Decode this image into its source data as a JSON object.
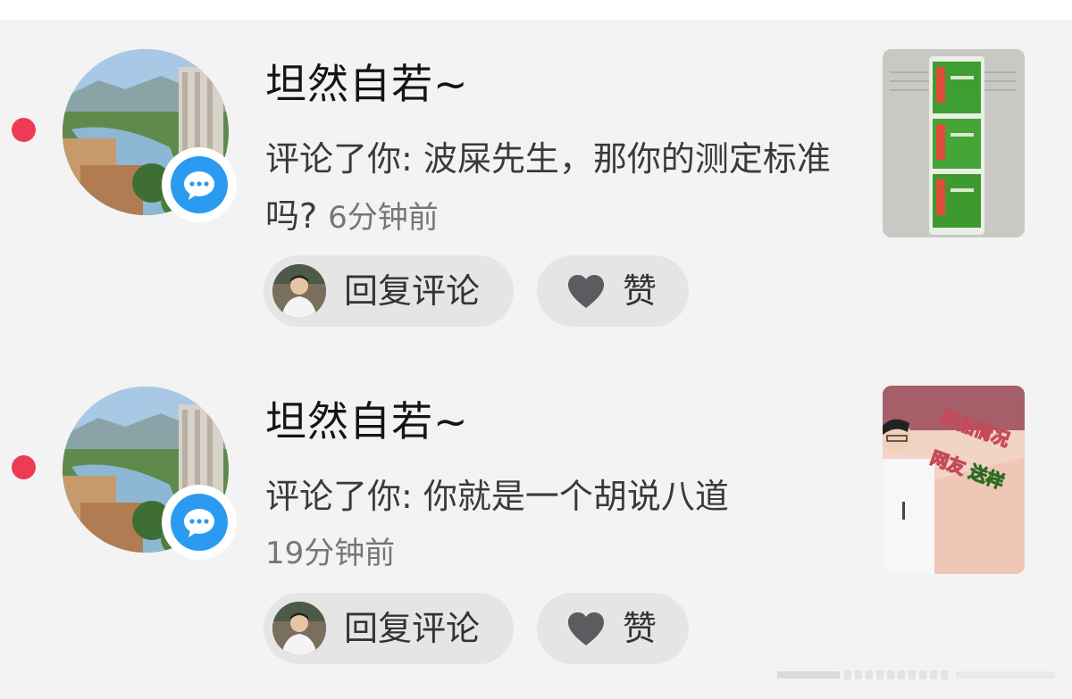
{
  "notifications": [
    {
      "username": "坦然自若~",
      "comment": "评论了你: 波屎先生，那你的测定标准吗?",
      "time": "6分钟前",
      "reply_label": "回复评论",
      "like_label": "赞",
      "thumbnail_icon": "green-medicine-packets-photo"
    },
    {
      "username": "坦然自若~",
      "comment": "评论了你: 你就是一个胡说八道",
      "time": "19分钟前",
      "reply_label": "回复评论",
      "like_label": "赞",
      "thumbnail_text": "药品情况",
      "thumbnail_text2": "网友",
      "thumbnail_text3": "送样"
    }
  ],
  "colors": {
    "background": "#f3f3f3",
    "unread_dot": "#ee3b55",
    "message_badge": "#2a9bf0",
    "button_bg": "#e5e5e5"
  },
  "icons": {
    "unread": "unread-dot-icon",
    "message": "chat-bubble-icon",
    "like": "heart-icon"
  }
}
